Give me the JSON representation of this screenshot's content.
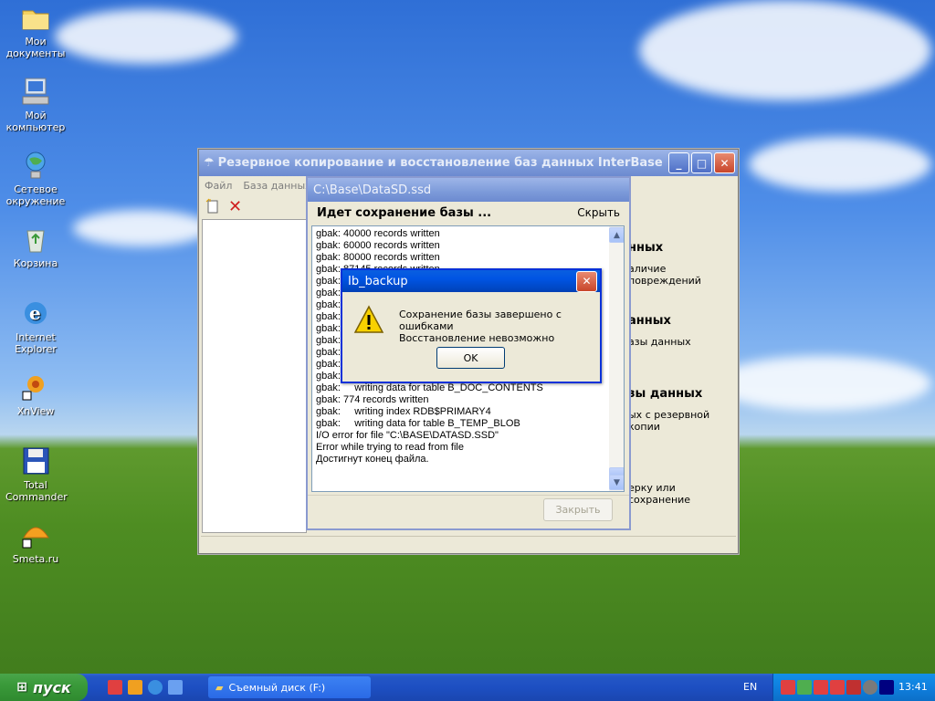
{
  "desktop": {
    "icons": [
      {
        "label": "Мои документы",
        "name": "desktop-icon-my-documents"
      },
      {
        "label": "Мой компьютер",
        "name": "desktop-icon-my-computer"
      },
      {
        "label": "Сетевое окружение",
        "name": "desktop-icon-network"
      },
      {
        "label": "Корзина",
        "name": "desktop-icon-recycle-bin"
      },
      {
        "label": "Internet Explorer",
        "name": "desktop-icon-ie"
      },
      {
        "label": "XnView",
        "name": "desktop-icon-xnview"
      },
      {
        "label": "Total Commander",
        "name": "desktop-icon-total-commander"
      },
      {
        "label": "Smeta.ru",
        "name": "desktop-icon-smeta"
      }
    ]
  },
  "main_window": {
    "title": "Резервное копирование и восстановление баз данных InterBase",
    "menu": [
      "Файл",
      "База данных"
    ],
    "right_panel": {
      "head1": "нных",
      "text1": "аличие повреждений",
      "head2": "анных",
      "text2": "азы данных",
      "head3": "зы данных",
      "text3": "ых с резервной копии",
      "text4": "ерку или сохранение"
    }
  },
  "progress_window": {
    "title": "C:\\Base\\DataSD.ssd",
    "heading": "Идет сохранение базы ...",
    "hide_label": "Скрыть",
    "close_label": "Закрыть",
    "log_lines": [
      "gbak: 40000 records written",
      "gbak: 60000 records written",
      "gbak: 80000 records written",
      "gbak: 87145 records written",
      "gbak:",
      "gbak:",
      "gbak:",
      "gbak:",
      "gbak:",
      "gbak:",
      "gbak:",
      "gbak:     writing index RDB$PRIMARY5",
      "gbak:     writing index B_DOC_CONTENTS_IDX_CRC",
      "gbak:     writing data for table B_DOC_CONTENTS",
      "gbak: 774 records written",
      "gbak:     writing index RDB$PRIMARY4",
      "gbak:     writing data for table B_TEMP_BLOB",
      "I/O error for file \"C:\\BASE\\DATASD.SSD\"",
      "Error while trying to read from file",
      "Достигнут конец файла."
    ]
  },
  "message_box": {
    "title": "Ib_backup",
    "line1": "Сохранение базы завершено с ошибками",
    "line2": "Восстановление невозможно",
    "ok_label": "OK"
  },
  "taskbar": {
    "start_label": "пуск",
    "task_label": "Съемный диск (F:)",
    "language": "EN",
    "clock": "13:41"
  },
  "colors": {
    "xp_blue": "#0054e3",
    "start_green": "#3a9a3a",
    "tray_blue": "#0f7fde"
  }
}
